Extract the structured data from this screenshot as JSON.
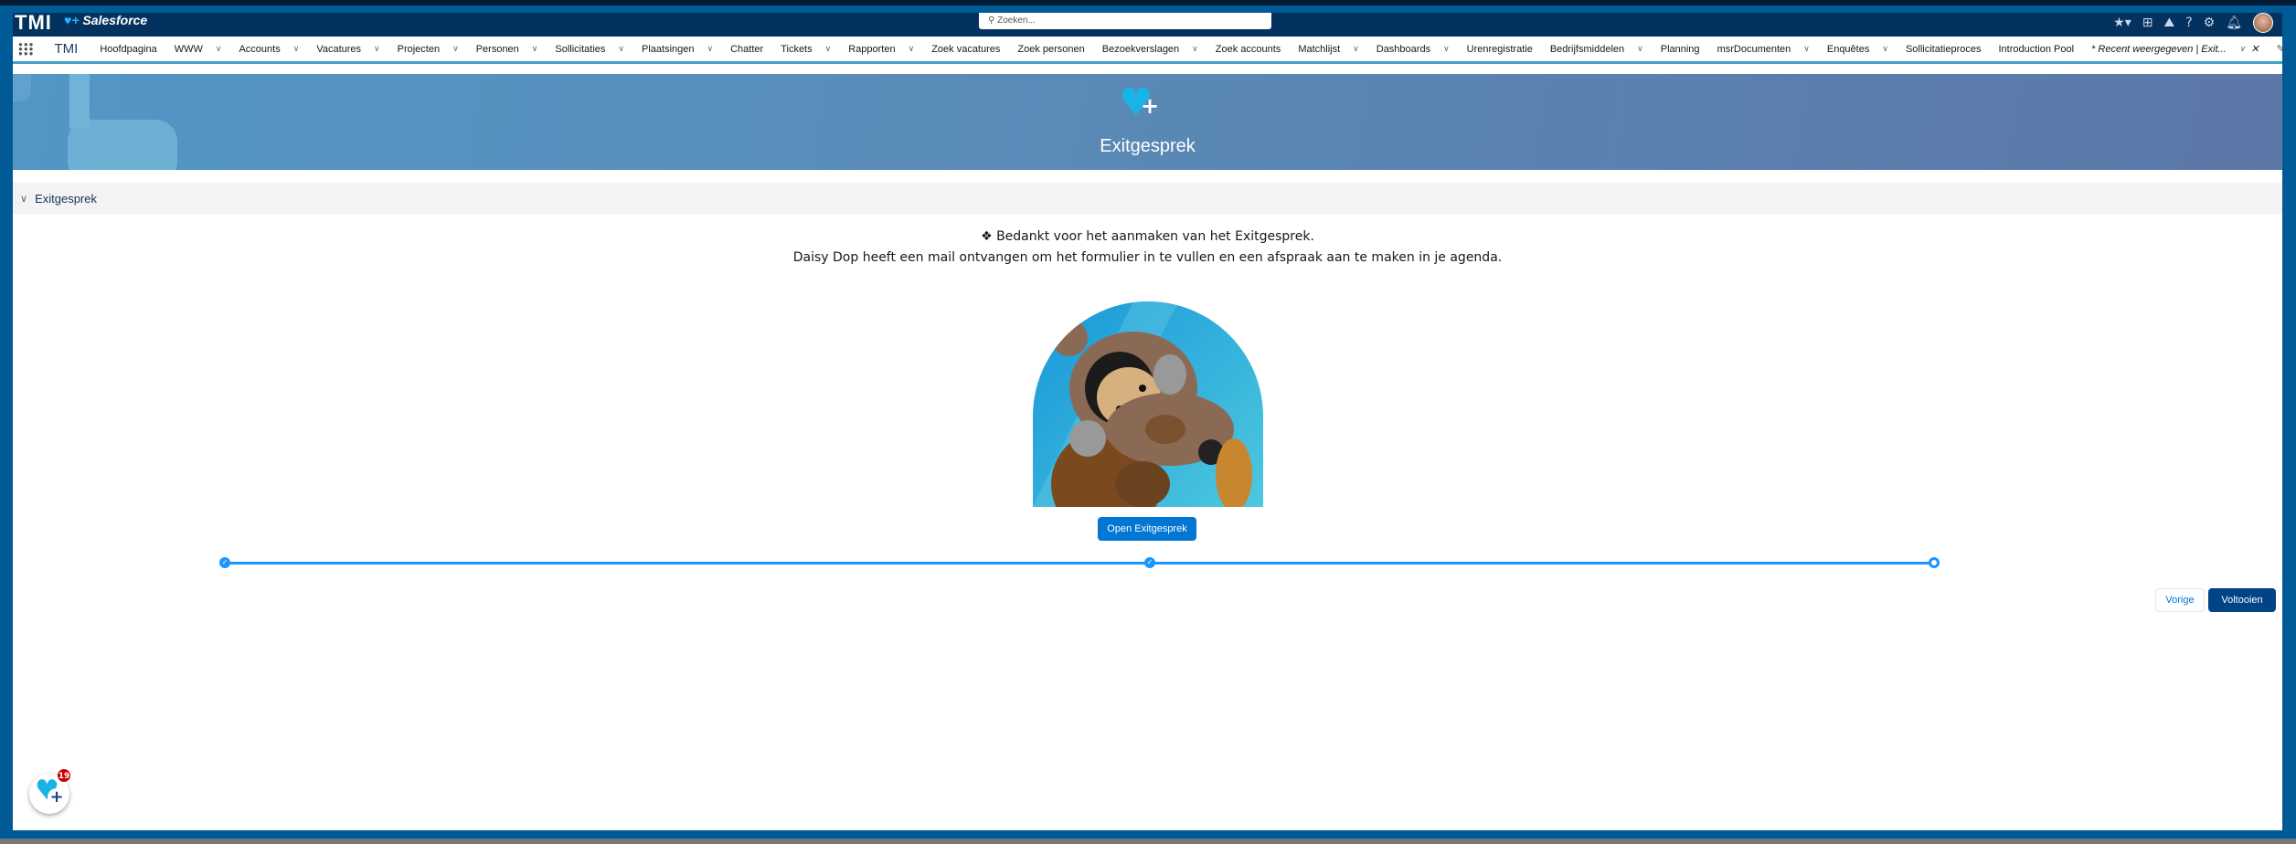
{
  "header": {
    "logo": "TMI",
    "brand": "Salesforce",
    "search_placeholder": "Zoeken..."
  },
  "nav": {
    "app_name": "TMI",
    "items": [
      {
        "label": "Hoofdpagina",
        "dropdown": false
      },
      {
        "label": "WWW",
        "dropdown": true
      },
      {
        "label": "Accounts",
        "dropdown": true
      },
      {
        "label": "Vacatures",
        "dropdown": true
      },
      {
        "label": "Projecten",
        "dropdown": true
      },
      {
        "label": "Personen",
        "dropdown": true
      },
      {
        "label": "Sollicitaties",
        "dropdown": true
      },
      {
        "label": "Plaatsingen",
        "dropdown": true
      },
      {
        "label": "Chatter",
        "dropdown": false
      },
      {
        "label": "Tickets",
        "dropdown": true
      },
      {
        "label": "Rapporten",
        "dropdown": true
      },
      {
        "label": "Zoek vacatures",
        "dropdown": false
      },
      {
        "label": "Zoek personen",
        "dropdown": false
      },
      {
        "label": "Bezoekverslagen",
        "dropdown": true
      },
      {
        "label": "Zoek accounts",
        "dropdown": false
      },
      {
        "label": "Matchlijst",
        "dropdown": true
      },
      {
        "label": "Dashboards",
        "dropdown": true
      },
      {
        "label": "Urenregistratie",
        "dropdown": false
      },
      {
        "label": "Bedrijfsmiddelen",
        "dropdown": true
      },
      {
        "label": "Planning",
        "dropdown": false
      },
      {
        "label": "msrDocumenten",
        "dropdown": true
      },
      {
        "label": "Enquêtes",
        "dropdown": true
      },
      {
        "label": "Sollicitatieproces",
        "dropdown": false
      },
      {
        "label": "Introduction Pool",
        "dropdown": false
      }
    ],
    "active_tab": "* Recent weergegeven | Exit..."
  },
  "banner": {
    "title": "Exitgesprek"
  },
  "section": {
    "title": "Exitgesprek"
  },
  "content": {
    "line1": "❖ Bedankt voor het aanmaken van het Exitgesprek.",
    "line2": "Daisy Dop heeft een mail ontvangen om het formulier in te vullen en een afspraak aan te maken in je agenda.",
    "open_button": "Open Exitgesprek"
  },
  "progress": {
    "steps_total": 3,
    "steps_completed": 2
  },
  "footer": {
    "previous": "Vorige",
    "finish": "Voltooien"
  },
  "fab": {
    "badge_count": "19"
  },
  "colors": {
    "brand": "#0176d3",
    "header": "#03325f",
    "finish": "#014486"
  }
}
